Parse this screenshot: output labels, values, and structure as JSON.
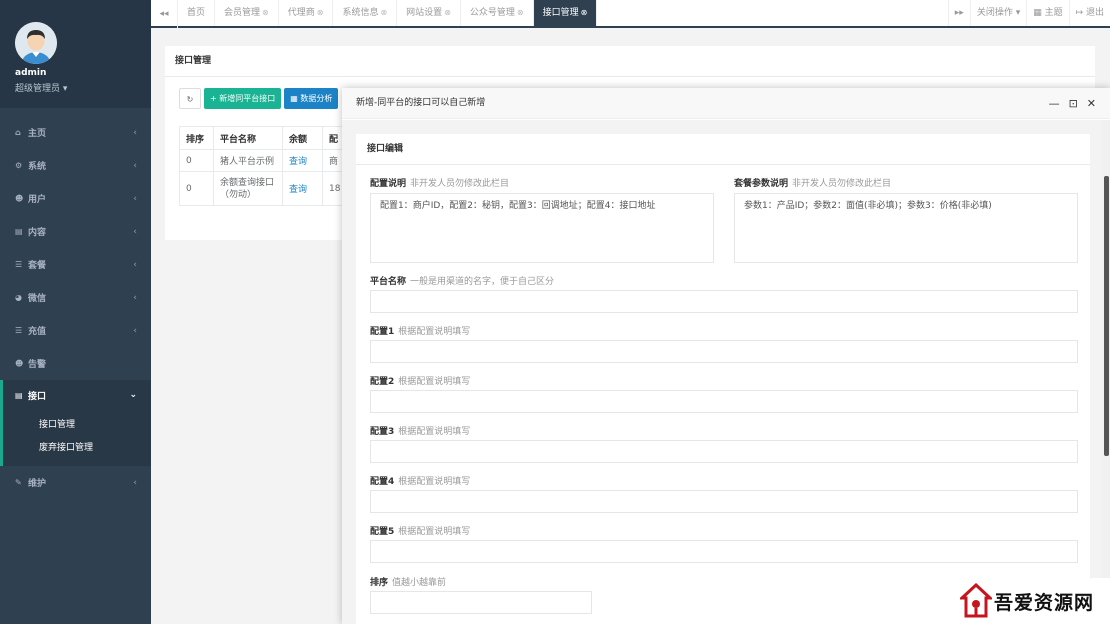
{
  "sidebar": {
    "user_name": "admin",
    "user_role": "超级管理员 ▾",
    "items": [
      {
        "icon": "home-icon",
        "glyph": "⌂",
        "label": "主页"
      },
      {
        "icon": "gears-icon",
        "glyph": "⚙",
        "label": "系统"
      },
      {
        "icon": "users-icon",
        "glyph": "☻",
        "label": "用户"
      },
      {
        "icon": "file-icon",
        "glyph": "▤",
        "label": "内容"
      },
      {
        "icon": "list-icon",
        "glyph": "☰",
        "label": "套餐"
      },
      {
        "icon": "wechat-icon",
        "glyph": "◕",
        "label": "微信"
      },
      {
        "icon": "list-icon",
        "glyph": "☰",
        "label": "充值"
      },
      {
        "icon": "users-icon",
        "glyph": "☻",
        "label": "告警"
      },
      {
        "icon": "file-icon",
        "glyph": "▤",
        "label": "接口"
      },
      {
        "icon": "wrench-icon",
        "glyph": "✎",
        "label": "维护"
      }
    ],
    "sub_items": [
      "接口管理",
      "废弃接口管理"
    ],
    "accent": "#19aa8d"
  },
  "topbar": {
    "back_glyph": "◂◂",
    "forward_glyph": "▸▸",
    "tabs": [
      "首页",
      "会员管理",
      "代理商",
      "系统信息",
      "网站设置",
      "公众号管理",
      "接口管理"
    ],
    "close_ops": "关闭操作 ▾",
    "theme": "▦ 主题",
    "logout": "↦ 退出"
  },
  "panel": {
    "title": "接口管理",
    "refresh_glyph": "↻",
    "add_button": "+ 新增同平台接口",
    "analysis_button": "▦ 数据分析",
    "table": {
      "headers": [
        "排序",
        "平台名称",
        "余额",
        "配"
      ],
      "rows": [
        [
          "0",
          "猪人平台示例",
          "查询",
          "商"
        ],
        [
          "0",
          "余额查询接口（勿动）",
          "查询",
          "18"
        ]
      ]
    }
  },
  "modal": {
    "title": "新增-同平台的接口可以自己新增",
    "min": "—",
    "max": "⊡",
    "close": "✕",
    "box_title": "接口编辑",
    "config_desc_label": "配置说明",
    "config_desc_hint": "非开发人员勿修改此栏目",
    "config_desc_value": "配置1：商户ID，配置2：秘钥，配置3：回调地址；配置4：接口地址",
    "param_desc_label": "套餐参数说明",
    "param_desc_hint": "非开发人员勿修改此栏目",
    "param_desc_value": "参数1：产品ID；参数2：面值(非必填)；参数3：价格(非必填)",
    "platform_label": "平台名称",
    "platform_hint": "一般是用渠道的名字，便于自己区分",
    "config1_label": "配置1",
    "config2_label": "配置2",
    "config3_label": "配置3",
    "config4_label": "配置4",
    "config5_label": "配置5",
    "config_hint": "根据配置说明填写",
    "sort_label": "排序",
    "sort_hint": "值越小越靠前"
  },
  "watermark": {
    "text": "吾爱资源网"
  }
}
